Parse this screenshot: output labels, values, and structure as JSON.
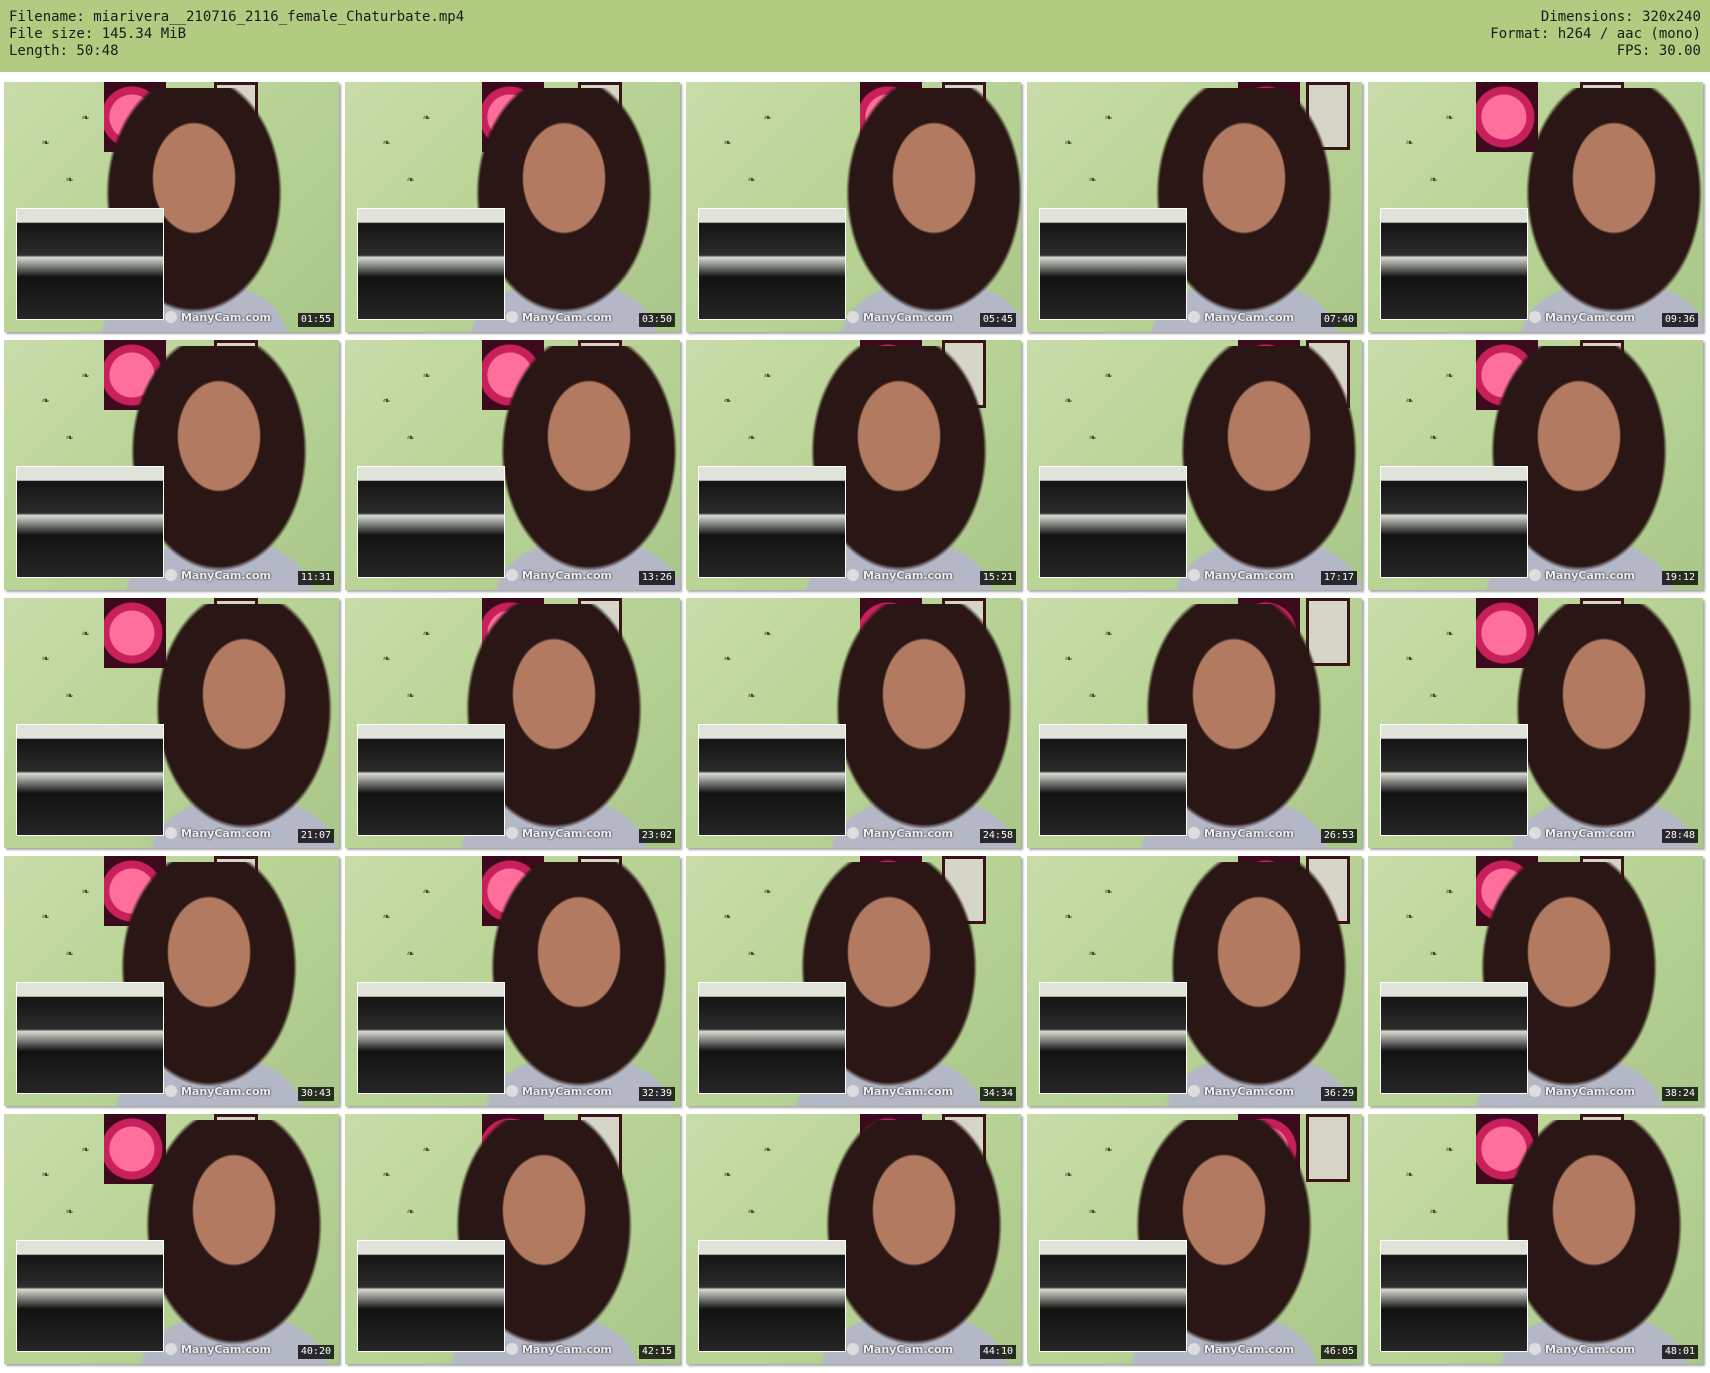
{
  "header": {
    "filename": "Filename: miarivera__210716_2116_female_Chaturbate.mp4",
    "filesize": "File size: 145.34 MiB",
    "length": "Length: 50:48",
    "dimensions": "Dimensions: 320x240",
    "format": "Format: h264 / aac (mono)",
    "fps": "FPS: 30.00",
    "background_color": "#b1cc81"
  },
  "watermark": "ManyCam.com",
  "thumbnails": [
    {
      "timestamp": "01:55"
    },
    {
      "timestamp": "03:50"
    },
    {
      "timestamp": "05:45"
    },
    {
      "timestamp": "07:40"
    },
    {
      "timestamp": "09:36"
    },
    {
      "timestamp": "11:31"
    },
    {
      "timestamp": "13:26"
    },
    {
      "timestamp": "15:21"
    },
    {
      "timestamp": "17:17"
    },
    {
      "timestamp": "19:12"
    },
    {
      "timestamp": "21:07"
    },
    {
      "timestamp": "23:02"
    },
    {
      "timestamp": "24:58"
    },
    {
      "timestamp": "26:53"
    },
    {
      "timestamp": "28:48"
    },
    {
      "timestamp": "30:43"
    },
    {
      "timestamp": "32:39"
    },
    {
      "timestamp": "34:34"
    },
    {
      "timestamp": "36:29"
    },
    {
      "timestamp": "38:24"
    },
    {
      "timestamp": "40:20"
    },
    {
      "timestamp": "42:15"
    },
    {
      "timestamp": "44:10"
    },
    {
      "timestamp": "46:05"
    },
    {
      "timestamp": "48:01"
    }
  ]
}
